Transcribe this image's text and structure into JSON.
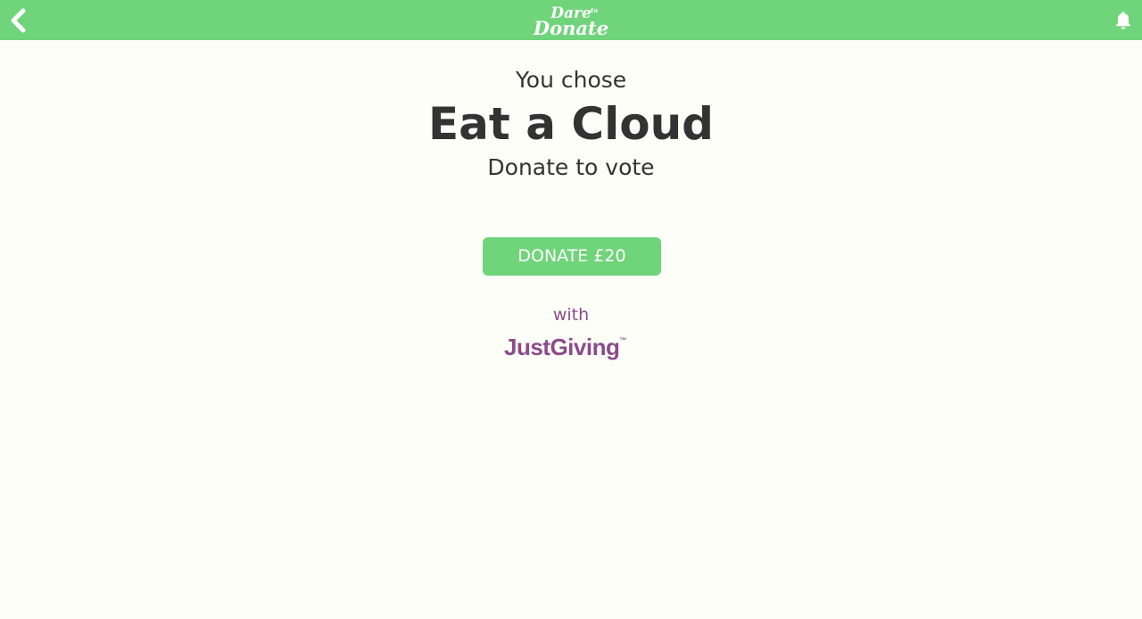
{
  "header": {
    "logo_text": {
      "line1": "Dare",
      "small": "to",
      "line2": "Donate"
    },
    "back_icon": "chevron-left-icon",
    "bell_icon": "bell-icon"
  },
  "main": {
    "intro": "You chose",
    "title": "Eat a Cloud",
    "subtitle": "Donate to vote",
    "donate_label": "DONATE £20",
    "with_label": "with",
    "partner_name": "JustGiving",
    "partner_tm": "™"
  },
  "colors": {
    "brand_green": "#6fd47a",
    "background": "#fefef8",
    "text_dark": "#333333",
    "partner_purple": "#8b4b8a"
  }
}
